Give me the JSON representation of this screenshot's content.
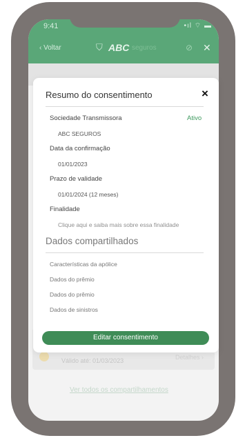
{
  "status_bar": {
    "time": "9:41",
    "icons": "•ıl ⌔ ▬"
  },
  "app_bar": {
    "back_label": "‹ Voltar",
    "brand": "ABC",
    "brand_sub": "seguros",
    "logo_icon": "shield-icon",
    "eye_icon": "eye-off-icon",
    "close_label": "✕"
  },
  "background": {
    "card_text": "Válido até: 01/03/2023",
    "card_right": "Detalhes ›",
    "link_text": "Ver todos os compartilhamentos"
  },
  "modal": {
    "title": "Resumo do consentimento",
    "close": "×",
    "sociedade_label": "Sociedade Transmissora",
    "status": "Ativo",
    "sociedade_value": "ABC SEGUROS",
    "confirmacao_label": "Data da confirmação",
    "confirmacao_value": "01/01/2023",
    "validade_label": "Prazo de validade",
    "validade_value": "01/01/2024 (12 meses)",
    "finalidade_label": "Finalidade",
    "finalidade_value": "Clique aqui e saiba mais sobre essa finalidade",
    "dados_title": "Dados compartilhados",
    "dados_items": [
      "Características da apólice",
      "Dados do prêmio",
      "Dados do prêmio",
      "Dados de sinistros"
    ],
    "edit_button": "Editar consentimento"
  },
  "colors": {
    "accent": "#3f8c57",
    "status_active": "#3f9a5f",
    "frame": "#7a7472"
  }
}
